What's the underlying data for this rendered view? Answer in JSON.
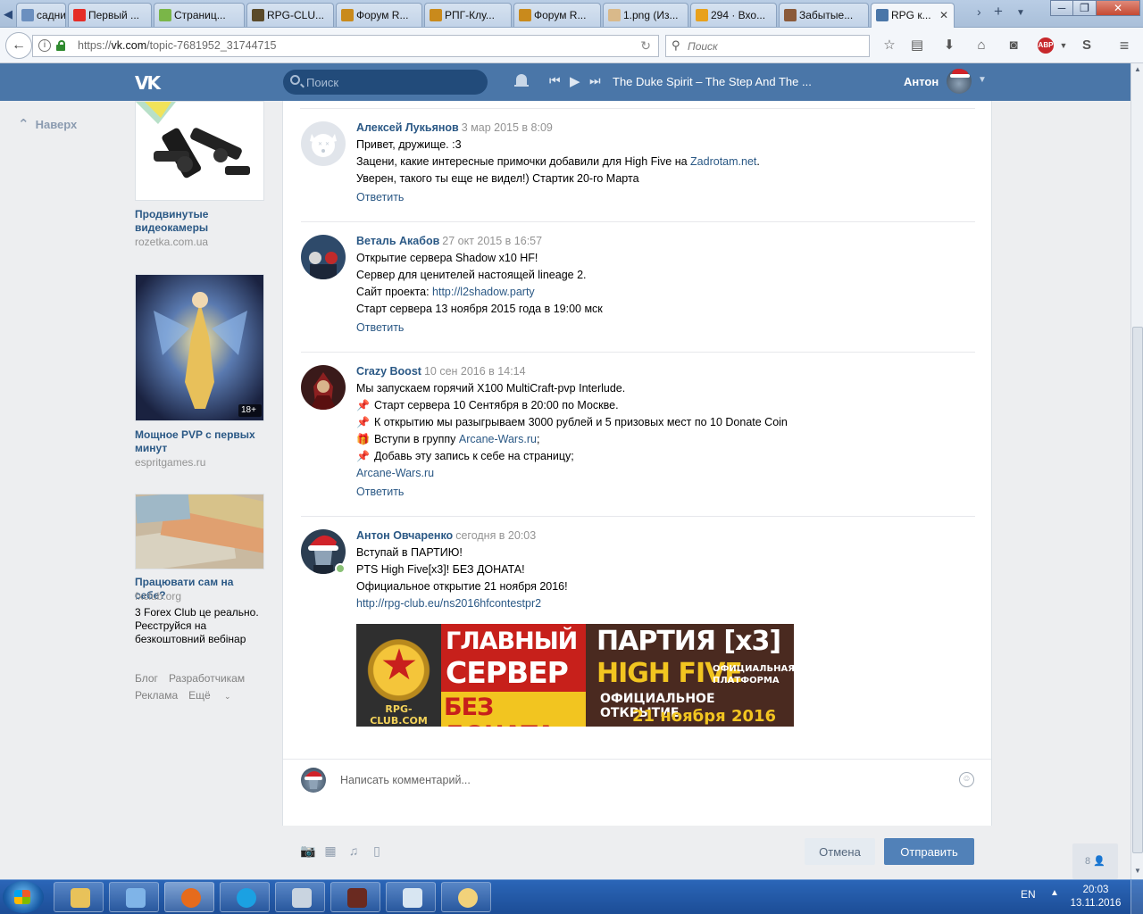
{
  "browser": {
    "tabs": [
      {
        "label": "садни...",
        "icon_color": "#6b8fbf",
        "icon": "page-icon"
      },
      {
        "label": "Первый ...",
        "icon_color": "#e52d27",
        "icon": "youtube-icon"
      },
      {
        "label": "Страниц...",
        "icon_color": "#7ab648",
        "icon": "site-icon"
      },
      {
        "label": "RPG-CLU...",
        "icon_color": "#5a4a2a",
        "icon": "rpg-club-icon"
      },
      {
        "label": "Форум R...",
        "icon_color": "#c98a1c",
        "icon": "forum-icon"
      },
      {
        "label": "РПГ-Клу...",
        "icon_color": "#c98a1c",
        "icon": "forum-icon"
      },
      {
        "label": "Форум R...",
        "icon_color": "#c98a1c",
        "icon": "forum-icon"
      },
      {
        "label": "1.png (Из...",
        "icon_color": "#d9b98a",
        "icon": "image-icon"
      },
      {
        "label": "294 · Вхо...",
        "icon_color": "#e8a11c",
        "icon": "mail-icon"
      },
      {
        "label": "Забытые...",
        "icon_color": "#8a5a3a",
        "icon": "game-icon"
      },
      {
        "label": "RPG к...",
        "icon_color": "#4a76a8",
        "icon": "vk-icon"
      }
    ],
    "url_prefix": "https://",
    "url_host": "vk.com",
    "url_path": "/topic-7681952_31744715",
    "search_placeholder": "Поиск",
    "abp_label": "ABP"
  },
  "vk_header": {
    "logo": "VK",
    "search_placeholder": "Поиск",
    "now_playing": "The Duke Spirit – The Step And The ...",
    "user_name": "Антон"
  },
  "left": {
    "up_link": "Наверх",
    "ads": [
      {
        "title": "Продвинутые видеокамеры",
        "domain": "rozetka.com.ua",
        "desc": ""
      },
      {
        "title": "Мощное PVP с первых минут",
        "domain": "espritgames.ru",
        "desc": "",
        "age_badge": "18+"
      },
      {
        "title": "Працювати сам на себе?",
        "domain": "fxclub.org",
        "desc": "3 Forex Club це реально. Реєструйся на безкоштовний вебінар"
      }
    ],
    "footer": {
      "blog": "Блог",
      "dev": "Разработчикам",
      "ads": "Реклама",
      "more": "Ещё"
    }
  },
  "comments": [
    {
      "author": "Алексей Лукьянов",
      "date": "3 мар 2015 в 8:09",
      "lines": [
        {
          "text": "Привет, дружище. :3"
        },
        {
          "text": "Зацени, какие интересные примочки добавили для High Five на ",
          "link": "Zadrotam.net",
          "after": "."
        },
        {
          "text": "Уверен, такого ты еще не видел!) Стартик 20-го Марта"
        }
      ],
      "reply": "Ответить"
    },
    {
      "author": "Веталь Акабов",
      "date": "27 окт 2015 в 16:57",
      "lines": [
        {
          "text": "Открытие сервера Shadow x10 HF!"
        },
        {
          "text": "Сервер для ценителей настоящей lineage 2."
        },
        {
          "text": "Сайт проекта: ",
          "link": "http://l2shadow.party"
        },
        {
          "text": "Старт сервера 13 ноября 2015 года в 19:00 мск"
        }
      ],
      "reply": "Ответить"
    },
    {
      "author": "Crazy Boost",
      "date": "10 сен 2016 в 14:14",
      "lines": [
        {
          "text": "Мы запускаем горячий X100 MultiCraft-pvp Interlude."
        },
        {
          "icon": "pin",
          "text": "Старт сервера 10 Сентября в 20:00 по Москве."
        },
        {
          "icon": "pin",
          "text": "К открытию мы разыгрываем 3000 рублей и 5 призовых мест по 10 Donate Coin"
        },
        {
          "icon": "gift",
          "text": "Вступи в группу ",
          "link": "Arcane-Wars.ru",
          "after": ";"
        },
        {
          "icon": "pin",
          "text": "Добавь эту запись к себе на страницу;"
        },
        {
          "text": "",
          "link": "Arcane-Wars.ru"
        }
      ],
      "reply": "Ответить"
    },
    {
      "author": "Антон Овчаренко",
      "date": "сегодня в 20:03",
      "lines": [
        {
          "text": "Вступай в ПАРТИЮ!"
        },
        {
          "text": "PTS High Five[x3]! БЕЗ ДОНАТА!"
        },
        {
          "text": "Официальное открытие 21 ноября 2016!"
        },
        {
          "text": "",
          "link": "http://rpg-club.eu/ns2016hfcontestpr2"
        }
      ],
      "banner": {
        "brand": "RPG-CLUB.COM",
        "line1": "ГЛАВНЫЙ",
        "line2": "СЕРВЕР",
        "line3": "БЕЗ ДОНАТА",
        "party": "ПАРТИЯ [x3]",
        "high_five": "HIGH FIVE",
        "platform": "ОФИЦИАЛЬНАЯ ПЛАТФОРМА",
        "opening": "ОФИЦИАЛЬНОЕ ОТКРЫТИЕ",
        "date": "21 ноября 2016"
      }
    }
  ],
  "composer": {
    "placeholder": "Написать комментарий...",
    "cancel": "Отмена",
    "send": "Отправить",
    "chat_count": "8"
  },
  "taskbar": {
    "lang": "EN",
    "time": "20:03",
    "date": "13.11.2016"
  },
  "colors": {
    "vk_blue": "#4a76a8",
    "link": "#2a5885",
    "button": "#5181b8"
  }
}
